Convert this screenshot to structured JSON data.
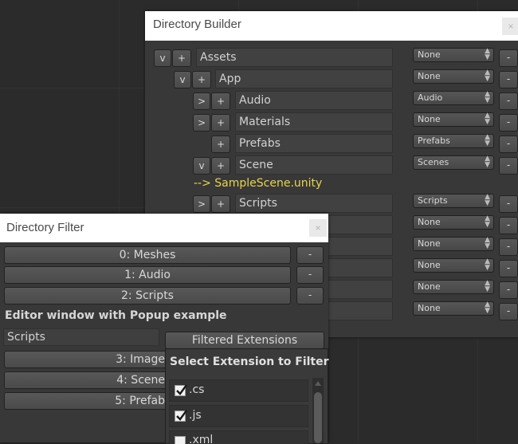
{
  "builder": {
    "title": "Directory Builder",
    "close": "×",
    "expand_open": "v",
    "expand_closed": ">",
    "add": "+",
    "remove": "-",
    "folders": [
      {
        "name": "Assets",
        "preset": "None"
      },
      {
        "name": "App",
        "preset": "None"
      },
      {
        "name": "Audio",
        "preset": "Audio"
      },
      {
        "name": "Materials",
        "preset": "None"
      },
      {
        "name": "Prefabs",
        "preset": "Prefabs"
      },
      {
        "name": "Scene",
        "preset": "Scenes"
      },
      {
        "name": "Scripts",
        "preset": "Scripts"
      }
    ],
    "extra_presets": [
      "None",
      "None",
      "None",
      "None",
      "None"
    ],
    "scene_file": "--> SampleScene.unity",
    "accent_color": "#e8d44d"
  },
  "filter": {
    "title": "Directory Filter",
    "close": "×",
    "remove": "-",
    "entries": [
      "0: Meshes",
      "1: Audio",
      "2: Scripts"
    ],
    "heading": "Editor window with Popup example",
    "selected_value": "Scripts",
    "filtered_button": "Filtered Extensions",
    "more_entries": [
      "3: Image",
      "4: Scene",
      "5: Prefab"
    ]
  },
  "extension_popup": {
    "title": "Select Extension to Filter",
    "options": [
      {
        "label": ".cs",
        "checked": true
      },
      {
        "label": ".js",
        "checked": true
      },
      {
        "label": ".xml",
        "checked": false
      }
    ]
  }
}
